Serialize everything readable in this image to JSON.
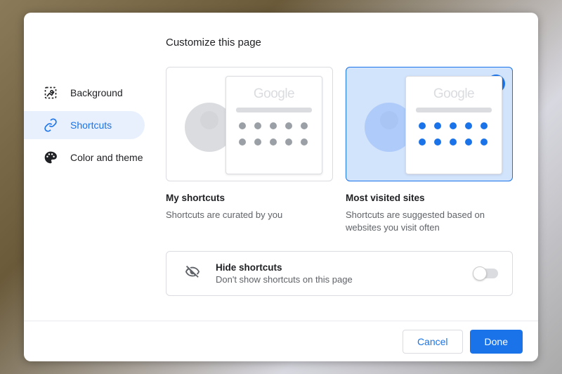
{
  "title": "Customize this page",
  "sidebar": {
    "items": [
      {
        "label": "Background"
      },
      {
        "label": "Shortcuts"
      },
      {
        "label": "Color and theme"
      }
    ],
    "activeIndex": 1
  },
  "options": {
    "my_shortcuts": {
      "title": "My shortcuts",
      "desc": "Shortcuts are curated by you",
      "logo": "Google"
    },
    "most_visited": {
      "title": "Most visited sites",
      "desc": "Shortcuts are suggested based on websites you visit often",
      "logo": "Google",
      "selected": true
    }
  },
  "hide": {
    "title": "Hide shortcuts",
    "desc": "Don't show shortcuts on this page",
    "enabled": false
  },
  "buttons": {
    "cancel": "Cancel",
    "done": "Done"
  }
}
